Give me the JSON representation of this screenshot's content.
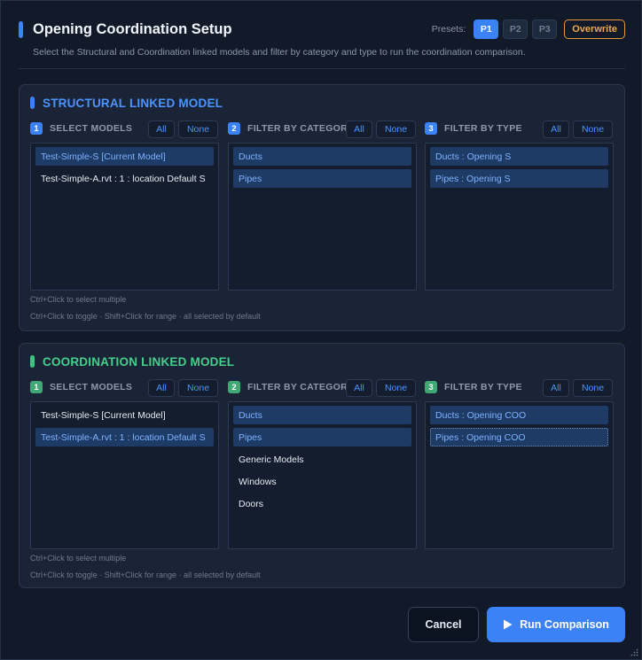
{
  "header": {
    "title": "Opening Coordination Setup",
    "subtitle": "Select the Structural and Coordination linked models and filter by category and type to run the coordination comparison.",
    "presets_label": "Presets:",
    "presets": [
      "P1",
      "P2",
      "P3"
    ],
    "overwrite_label": "Overwrite"
  },
  "common": {
    "all_label": "All",
    "none_label": "None",
    "select_models_label": "SELECT MODELS",
    "filter_category_label": "FILTER BY CATEGORY",
    "filter_type_label": "FILTER BY TYPE",
    "step1": "1",
    "step2": "2",
    "step3": "3",
    "hint1": "Ctrl+Click to select multiple",
    "hint2": "Ctrl+Click to toggle · Shift+Click for range · all selected by default"
  },
  "structural": {
    "title": "STRUCTURAL LINKED MODEL",
    "models": [
      "Test-Simple-S  [Current Model]",
      "Test-Simple-A.rvt : 1 : location Default S"
    ],
    "categories": [
      "Ducts",
      "Pipes"
    ],
    "types": [
      "Ducts : Opening S",
      "Pipes : Opening S"
    ]
  },
  "coordination": {
    "title": "COORDINATION LINKED MODEL",
    "models": [
      "Test-Simple-S  [Current Model]",
      "Test-Simple-A.rvt : 1 : location Default S"
    ],
    "categories": [
      "Ducts",
      "Pipes",
      "Generic Models",
      "Windows",
      "Doors"
    ],
    "types": [
      "Ducts : Opening COO",
      "Pipes : Opening COO"
    ]
  },
  "footer": {
    "cancel_label": "Cancel",
    "run_label": "Run Comparison"
  },
  "colors": {
    "accent_blue": "#3b82f6",
    "accent_green": "#3fc380",
    "overwrite_orange": "#f0a64a"
  }
}
